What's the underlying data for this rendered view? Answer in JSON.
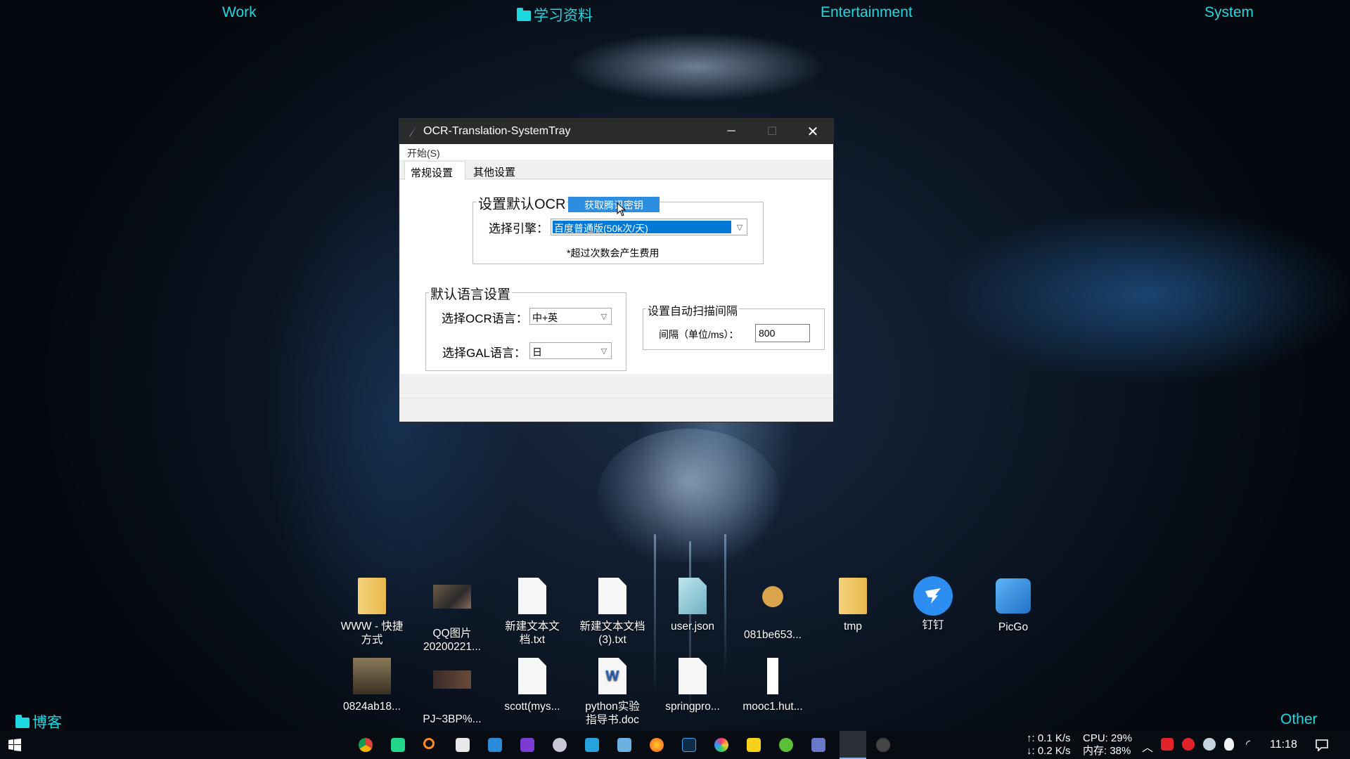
{
  "desktop": {
    "top_labels": [
      "Work",
      "学习资料",
      "Entertainment",
      "System"
    ],
    "bottom_left_label": "博客",
    "bottom_right_label": "Other",
    "icons_row1": [
      {
        "label": "WWW - 快捷\n方式",
        "icon": "folder-shortcut-icon"
      },
      {
        "label": "QQ图片\n20200221...",
        "icon": "image-icon"
      },
      {
        "label": "新建文本文\n档.txt",
        "icon": "text-file-icon"
      },
      {
        "label": "新建文本文档\n(3).txt",
        "icon": "text-file-icon"
      },
      {
        "label": "user.json",
        "icon": "json-file-icon"
      },
      {
        "label": "081be653...",
        "icon": "image-icon"
      },
      {
        "label": "tmp",
        "icon": "folder-icon"
      },
      {
        "label": "钉钉",
        "icon": "dingtalk-icon"
      },
      {
        "label": "PicGo",
        "icon": "picgo-icon"
      }
    ],
    "icons_row2": [
      {
        "label": "0824ab18...",
        "icon": "image-icon"
      },
      {
        "label": "PJ~3BP%...",
        "icon": "image-icon"
      },
      {
        "label": "scott(mys...",
        "icon": "text-file-icon"
      },
      {
        "label": "python实验\n指导书.doc",
        "icon": "word-file-icon"
      },
      {
        "label": "springpro...",
        "icon": "text-file-icon"
      },
      {
        "label": "mooc1.hut...",
        "icon": "file-icon"
      }
    ]
  },
  "window": {
    "title": "OCR-Translation-SystemTray",
    "menu": "开始(S)",
    "tabs": [
      "常规设置",
      "其他设置"
    ],
    "ocr_group": {
      "title": "设置默认OCR",
      "get_key_button": "获取腾讯密钥",
      "engine_label": "选择引擎：",
      "engine_value": "百度普通版(50k次/天)",
      "note": "*超过次数会产生费用"
    },
    "lang_group": {
      "title": "默认语言设置",
      "ocr_lang_label": "选择OCR语言：",
      "ocr_lang_value": "中+英",
      "gal_lang_label": "选择GAL语言：",
      "gal_lang_value": "日"
    },
    "scan_group": {
      "title": "设置自动扫描间隔",
      "interval_label": "间隔（单位/ms）：",
      "interval_value": "800"
    }
  },
  "taskbar": {
    "net_up": "↑: 0.1 K/s",
    "net_down": "↓: 0.2 K/s",
    "cpu": "CPU: 29%",
    "mem": "内存: 38%",
    "time": "11:18"
  }
}
